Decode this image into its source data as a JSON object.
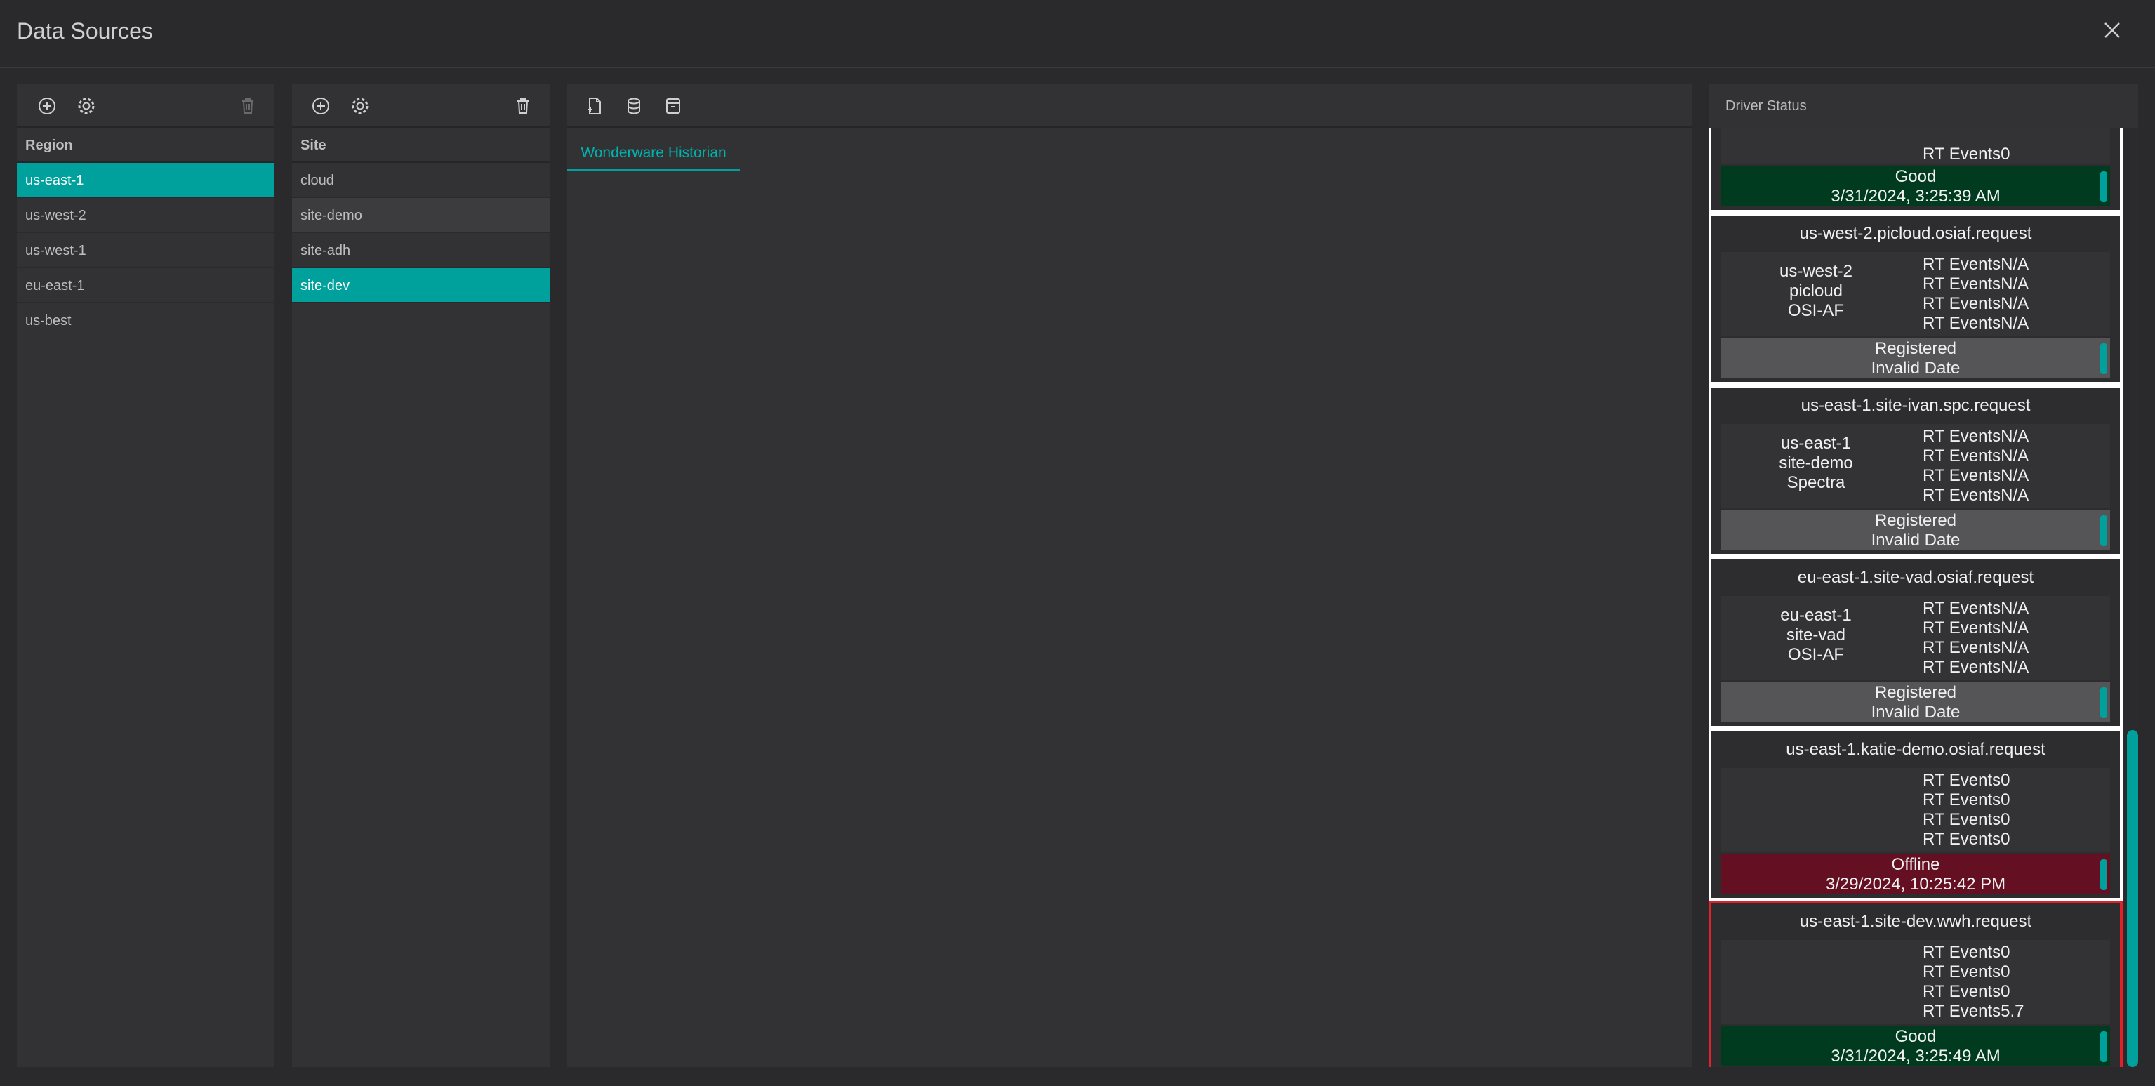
{
  "window": {
    "title": "Data Sources"
  },
  "regions": {
    "header": "Region",
    "items": [
      "us-east-1",
      "us-west-2",
      "us-west-1",
      "eu-east-1",
      "us-best"
    ],
    "selected": 0
  },
  "sites": {
    "header": "Site",
    "items": [
      "cloud",
      "site-demo",
      "site-adh",
      "site-dev"
    ],
    "selected": 3,
    "hovered": 1
  },
  "main": {
    "tabs": [
      {
        "label": "Wonderware Historian"
      }
    ]
  },
  "driver_status": {
    "header": "Driver Status",
    "top_partial": {
      "event_line": "RT Events0",
      "status": "Good",
      "date": "3/31/2024, 3:25:39 AM"
    },
    "cards": [
      {
        "name": "us-west-2.picloud.osiaf.request",
        "info": [
          "us-west-2",
          "picloud",
          "OSI-AF"
        ],
        "events": [
          "RT EventsN/A",
          "RT EventsN/A",
          "RT EventsN/A",
          "RT EventsN/A"
        ],
        "status": "Registered",
        "date": "Invalid Date"
      },
      {
        "name": "us-east-1.site-ivan.spc.request",
        "info": [
          "us-east-1",
          "site-demo",
          "Spectra"
        ],
        "events": [
          "RT EventsN/A",
          "RT EventsN/A",
          "RT EventsN/A",
          "RT EventsN/A"
        ],
        "status": "Registered",
        "date": "Invalid Date"
      },
      {
        "name": "eu-east-1.site-vad.osiaf.request",
        "info": [
          "eu-east-1",
          "site-vad",
          "OSI-AF"
        ],
        "events": [
          "RT EventsN/A",
          "RT EventsN/A",
          "RT EventsN/A",
          "RT EventsN/A"
        ],
        "status": "Registered",
        "date": "Invalid Date"
      },
      {
        "name": "us-east-1.katie-demo.osiaf.request",
        "info": [],
        "events": [
          "RT Events0",
          "RT Events0",
          "RT Events0",
          "RT Events0"
        ],
        "status": "Offline",
        "date": "3/29/2024, 10:25:42 PM"
      },
      {
        "name": "us-east-1.site-dev.wwh.request",
        "info": [],
        "events": [
          "RT Events0",
          "RT Events0",
          "RT Events0",
          "RT Events5.7"
        ],
        "status": "Good",
        "date": "3/31/2024, 3:25:49 AM"
      }
    ]
  },
  "colors": {
    "accent": "#00a19d",
    "good": "#003b1f",
    "registered": "#555557",
    "offline": "#650f22",
    "highlight": "#e2202a"
  }
}
